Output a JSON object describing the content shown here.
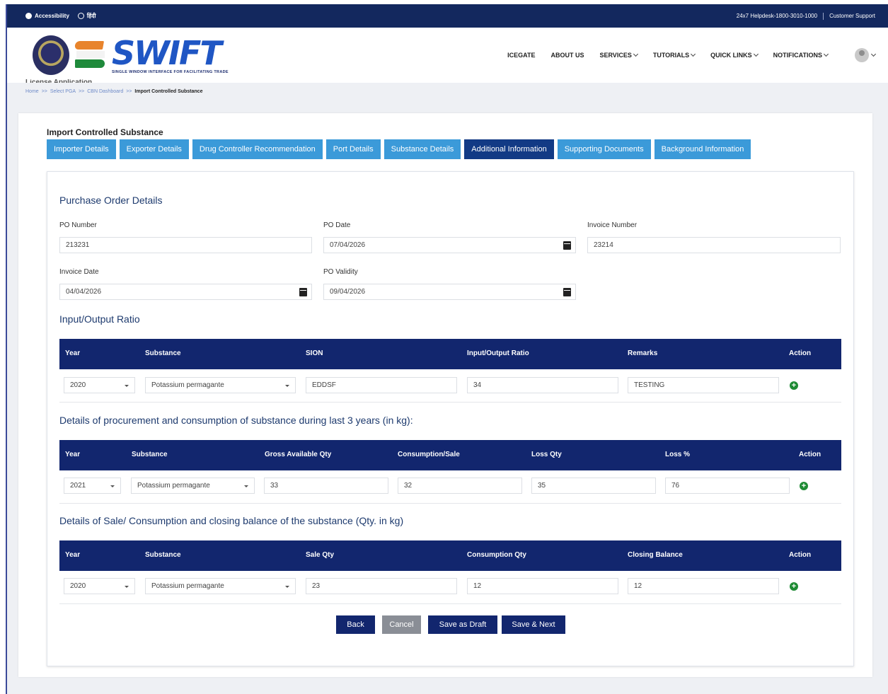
{
  "topbar": {
    "accessibility": "Accessibility",
    "language": "हिंदी",
    "helpdesk": "24x7 Helpdesk-1800-3010-1000",
    "support": "Customer Support"
  },
  "brand": {
    "name": "SWIFT",
    "tagline": "SINGLE WINDOW INTERFACE FOR FACILITATING TRADE"
  },
  "nav": {
    "items": [
      "ICEGATE",
      "ABOUT US",
      "SERVICES",
      "TUTORIALS",
      "QUICK LINKS",
      "NOTIFICATIONS"
    ]
  },
  "page": {
    "cut_title": "License Application"
  },
  "breadcrumb": {
    "home": "Home",
    "select_pga": "Select PGA",
    "cbn_dashboard": "CBN Dashboard",
    "current": "Import Controlled Substance",
    "sep": ">>"
  },
  "card": {
    "title": "Import Controlled Substance"
  },
  "tabs": [
    "Importer Details",
    "Exporter Details",
    "Drug Controller Recommendation",
    "Port Details",
    "Substance Details",
    "Additional Information",
    "Supporting Documents",
    "Background Information"
  ],
  "po": {
    "title": "Purchase Order Details",
    "po_number_label": "PO Number",
    "po_number": "213231",
    "po_date_label": "PO Date",
    "po_date": "07/04/2026",
    "invoice_number_label": "Invoice Number",
    "invoice_number": "23214",
    "invoice_date_label": "Invoice Date",
    "invoice_date": "04/04/2026",
    "po_validity_label": "PO Validity",
    "po_validity": "09/04/2026"
  },
  "ratio": {
    "title": "Input/Output Ratio",
    "headers": [
      "Year",
      "Substance",
      "SION",
      "Input/Output Ratio",
      "Remarks",
      "Action"
    ],
    "row": {
      "year": "2020",
      "substance": "Potassium permagante",
      "sion": "EDDSF",
      "ratio": "34",
      "remarks": "TESTING"
    }
  },
  "procurement": {
    "title": "Details of procurement and consumption of substance during last 3 years (in kg):",
    "headers": [
      "Year",
      "Substance",
      "Gross Available Qty",
      "Consumption/Sale",
      "Loss Qty",
      "Loss %",
      "Action"
    ],
    "row": {
      "year": "2021",
      "substance": "Potassium permagante",
      "gross": "33",
      "consumption": "32",
      "loss_qty": "35",
      "loss_pct": "76"
    }
  },
  "sale": {
    "title": "Details of Sale/ Consumption and closing balance of the substance (Qty. in kg)",
    "headers": [
      "Year",
      "Substance",
      "Sale Qty",
      "Consumption Qty",
      "Closing Balance",
      "Action"
    ],
    "row": {
      "year": "2020",
      "substance": "Potassium permagante",
      "sale_qty": "23",
      "consumption_qty": "12",
      "closing_balance": "12"
    }
  },
  "buttons": {
    "back": "Back",
    "cancel": "Cancel",
    "save_draft": "Save as Draft",
    "save_next": "Save & Next"
  },
  "icons": {
    "add": "+",
    "info": "info-icon",
    "globe": "globe-icon",
    "calendar": "calendar-icon"
  }
}
